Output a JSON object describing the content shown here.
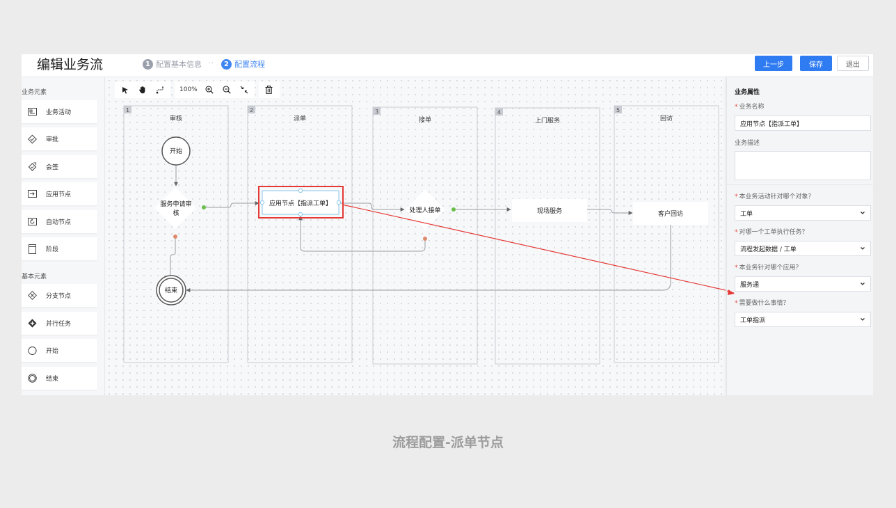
{
  "header": {
    "title": "编辑业务流",
    "steps": [
      {
        "num": "1",
        "label": "配置基本信息"
      },
      {
        "num": "2",
        "label": "配置流程"
      }
    ],
    "step_separator": "··",
    "prev_label": "上一步",
    "save_label": "保存",
    "exit_label": "退出"
  },
  "sidebar": {
    "group1": "业务元素",
    "items1": [
      {
        "label": "业务活动",
        "icon": "activity-icon"
      },
      {
        "label": "审批",
        "icon": "approve-icon"
      },
      {
        "label": "会签",
        "icon": "countersign-icon"
      },
      {
        "label": "应用节点",
        "icon": "app-node-icon"
      },
      {
        "label": "自动节点",
        "icon": "auto-node-icon"
      },
      {
        "label": "阶段",
        "icon": "stage-icon"
      }
    ],
    "group2": "基本元素",
    "items2": [
      {
        "label": "分支节点",
        "icon": "branch-icon"
      },
      {
        "label": "并行任务",
        "icon": "parallel-icon"
      },
      {
        "label": "开始",
        "icon": "start-icon"
      },
      {
        "label": "结束",
        "icon": "end-icon"
      }
    ]
  },
  "toolbar": {
    "zoom": "100%"
  },
  "flow": {
    "lanes": [
      {
        "num": "1",
        "title": "审核"
      },
      {
        "num": "2",
        "title": "派单"
      },
      {
        "num": "3",
        "title": "接单"
      },
      {
        "num": "4",
        "title": "上门服务"
      },
      {
        "num": "5",
        "title": "回访"
      }
    ],
    "start": "开始",
    "review_line1": "服务申请审",
    "review_line2": "核",
    "dispatch": "应用节点【指派工单】",
    "handler": "处理人接单",
    "onsite": "现场服务",
    "revisit": "客户回访",
    "end": "结束",
    "highlight_color": "#e53935"
  },
  "props": {
    "title": "业务属性",
    "name_label": "业务名称",
    "name_value": "应用节点【指派工单】",
    "desc_label": "业务描述",
    "q1_label": "本业务活动针对哪个对象？",
    "q1_value": "工单",
    "q2_label": "对哪一个工单执行任务？",
    "q2_value": "流程发起数据 / 工单",
    "q3_label": "本业务针对哪个应用？",
    "q3_value": "服务通",
    "q4_label": "需要做什么事情？",
    "q4_value": "工单指派"
  },
  "caption": "流程配置-派单节点"
}
